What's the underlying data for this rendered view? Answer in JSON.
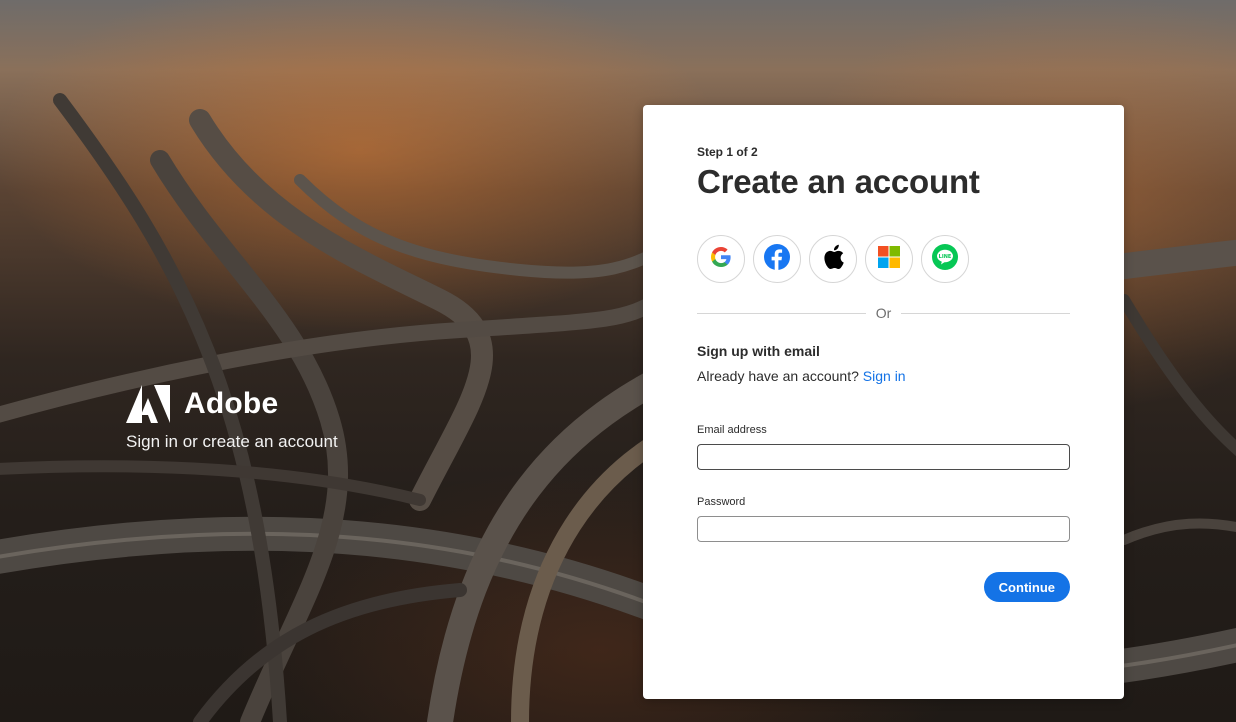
{
  "brand": {
    "name": "Adobe",
    "tagline": "Sign in or create an account"
  },
  "form": {
    "step": "Step 1 of 2",
    "title": "Create an account",
    "social": [
      {
        "provider": "Google",
        "icon": "google-icon"
      },
      {
        "provider": "Facebook",
        "icon": "facebook-icon"
      },
      {
        "provider": "Apple",
        "icon": "apple-icon"
      },
      {
        "provider": "Microsoft",
        "icon": "microsoft-icon"
      },
      {
        "provider": "LINE",
        "icon": "line-icon"
      }
    ],
    "separator": "Or",
    "email_section_title": "Sign up with email",
    "already_text": "Already have an account?",
    "sign_in_link": "Sign in",
    "email_label": "Email address",
    "email_value": "",
    "password_label": "Password",
    "password_value": "",
    "continue_label": "Continue"
  },
  "colors": {
    "accent": "#1473e6",
    "facebook": "#1877f2",
    "line": "#06c755"
  }
}
